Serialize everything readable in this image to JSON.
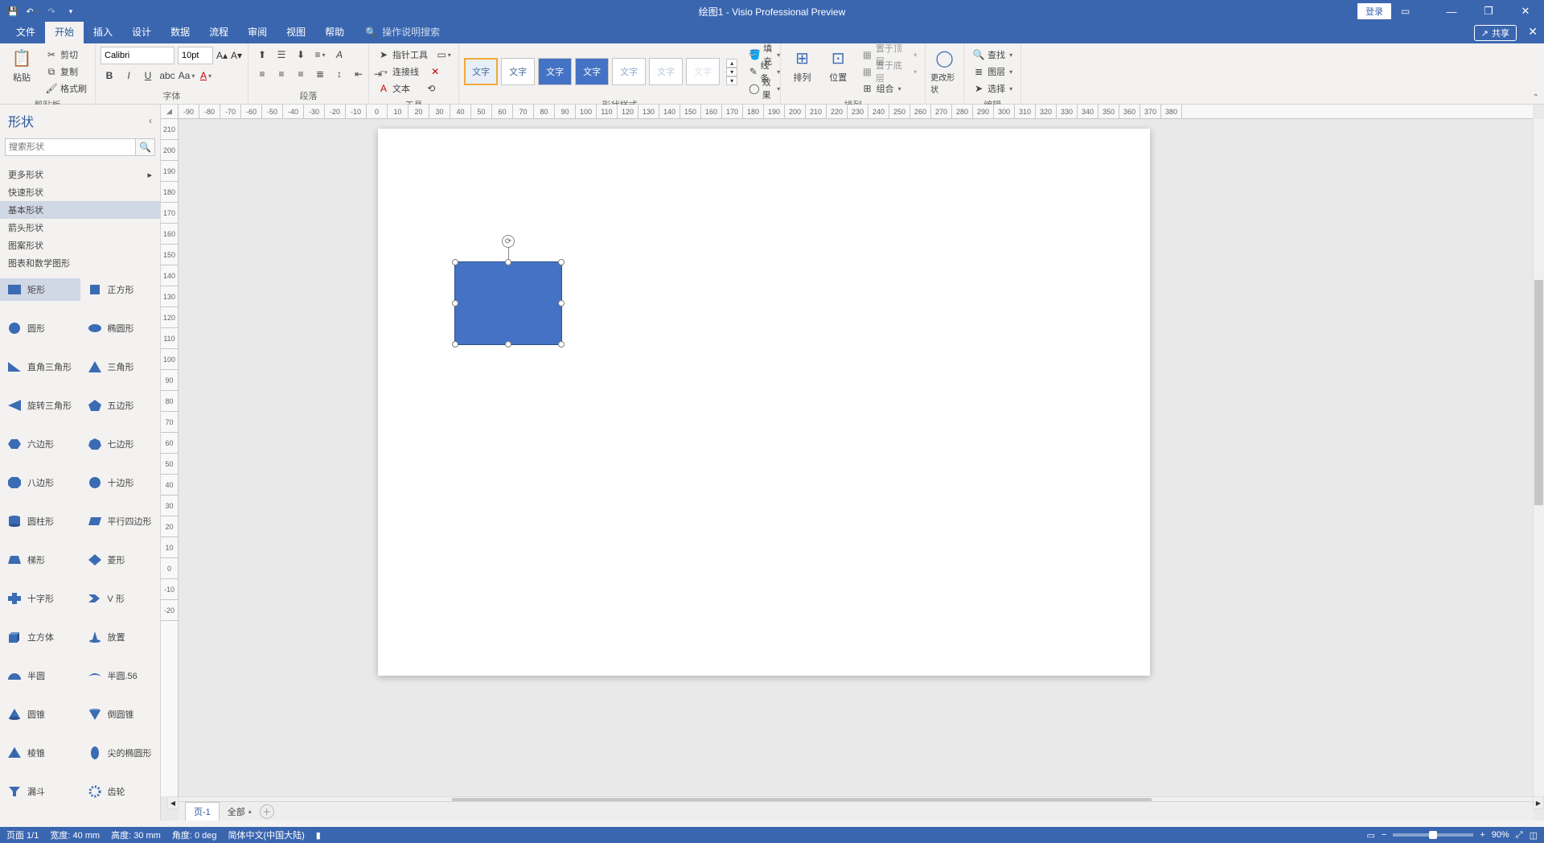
{
  "titlebar": {
    "doc_title": "绘图1",
    "app_title": "Visio Professional Preview",
    "separator": "  -  ",
    "login": "登录"
  },
  "menu": {
    "tabs": [
      "文件",
      "开始",
      "插入",
      "设计",
      "数据",
      "流程",
      "审阅",
      "视图",
      "帮助"
    ],
    "active_index": 1,
    "search_placeholder": "操作说明搜索",
    "share": "共享"
  },
  "ribbon": {
    "clipboard": {
      "paste": "粘贴",
      "cut": "剪切",
      "copy": "复制",
      "format_painter": "格式刷",
      "label": "剪贴板"
    },
    "font": {
      "name": "Calibri",
      "size": "10pt",
      "label": "字体"
    },
    "paragraph": {
      "label": "段落"
    },
    "tools": {
      "pointer": "指针工具",
      "connector": "连接线",
      "text": "文本",
      "label": "工具"
    },
    "styles": {
      "style_text": "文字",
      "label": "形状样式",
      "fill": "填充",
      "line": "线条",
      "effects": "效果"
    },
    "arrange": {
      "arrange": "排列",
      "position": "位置",
      "bring_front": "置于顶层",
      "send_back": "置于底层",
      "group": "组合",
      "label": "排列"
    },
    "change_shape": "更改形状",
    "editing": {
      "find": "查找",
      "layers": "图层",
      "select": "选择",
      "label": "编辑"
    }
  },
  "shapes_pane": {
    "title": "形状",
    "search_placeholder": "搜索形状",
    "categories": [
      "更多形状",
      "快速形状",
      "基本形状",
      "箭头形状",
      "图案形状",
      "图表和数学图形"
    ],
    "active_category_index": 2,
    "shapes": [
      {
        "n": "矩形",
        "sel": true
      },
      {
        "n": "正方形"
      },
      {
        "n": "圆形"
      },
      {
        "n": "椭圆形"
      },
      {
        "n": "直角三角形"
      },
      {
        "n": "三角形"
      },
      {
        "n": "旋转三角形"
      },
      {
        "n": "五边形"
      },
      {
        "n": "六边形"
      },
      {
        "n": "七边形"
      },
      {
        "n": "八边形"
      },
      {
        "n": "十边形"
      },
      {
        "n": "圆柱形"
      },
      {
        "n": "平行四边形"
      },
      {
        "n": "梯形"
      },
      {
        "n": "菱形"
      },
      {
        "n": "十字形"
      },
      {
        "n": "V 形"
      },
      {
        "n": "立方体"
      },
      {
        "n": "放置"
      },
      {
        "n": "半圆"
      },
      {
        "n": "半圆.56"
      },
      {
        "n": "圆锥"
      },
      {
        "n": "倒圆锥"
      },
      {
        "n": "棱锥"
      },
      {
        "n": "尖的椭圆形"
      },
      {
        "n": "漏斗"
      },
      {
        "n": "齿轮"
      }
    ]
  },
  "ruler_h": [
    -90,
    -80,
    -70,
    -60,
    -50,
    -40,
    -30,
    -20,
    -10,
    0,
    10,
    20,
    30,
    40,
    50,
    60,
    70,
    80,
    90,
    100,
    110,
    120,
    130,
    140,
    150,
    160,
    170,
    180,
    190,
    200,
    210,
    220,
    230,
    240,
    250,
    260,
    270,
    280,
    290,
    300,
    310,
    320,
    330,
    340,
    350,
    360,
    370,
    380
  ],
  "ruler_v": [
    210,
    200,
    190,
    180,
    170,
    160,
    150,
    140,
    130,
    120,
    110,
    100,
    90,
    80,
    70,
    60,
    50,
    40,
    30,
    20,
    10,
    0,
    -10,
    -20
  ],
  "page_tabs": {
    "page": "页-1",
    "all": "全部"
  },
  "status": {
    "page": "页面 1/1",
    "width": "宽度: 40 mm",
    "height": "高度: 30 mm",
    "angle": "角度: 0 deg",
    "lang": "简体中文(中国大陆)",
    "zoom": "90%"
  }
}
